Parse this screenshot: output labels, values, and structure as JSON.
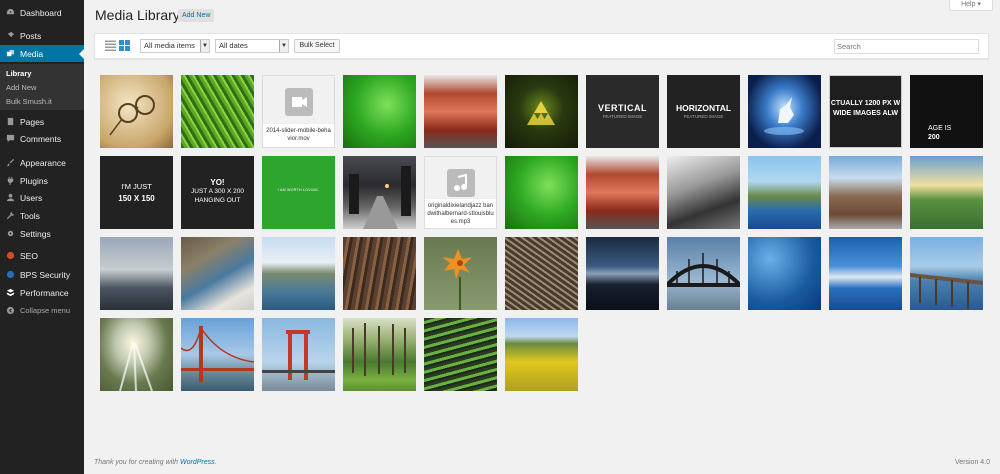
{
  "sidebar": {
    "items": [
      {
        "label": "Dashboard",
        "icon": "dashboard-icon"
      },
      {
        "label": "Posts",
        "icon": "pin-icon"
      },
      {
        "label": "Media",
        "icon": "media-icon"
      },
      {
        "label": "Pages",
        "icon": "page-icon"
      },
      {
        "label": "Comments",
        "icon": "comment-icon"
      },
      {
        "label": "Appearance",
        "icon": "brush-icon"
      },
      {
        "label": "Plugins",
        "icon": "plug-icon"
      },
      {
        "label": "Users",
        "icon": "user-icon"
      },
      {
        "label": "Tools",
        "icon": "wrench-icon"
      },
      {
        "label": "Settings",
        "icon": "settings-icon"
      },
      {
        "label": "SEO",
        "icon": "seo-icon"
      },
      {
        "label": "BPS Security",
        "icon": "shield-icon"
      },
      {
        "label": "Performance",
        "icon": "performance-icon"
      },
      {
        "label": "Collapse menu",
        "icon": "collapse-icon"
      }
    ],
    "submenu": [
      "Library",
      "Add New",
      "Bulk Smush.it"
    ]
  },
  "header": {
    "title": "Media Library",
    "add_new": "Add New",
    "help": "Help ▾"
  },
  "toolbar": {
    "filter_type": "All media items",
    "filter_date": "All dates",
    "bulk_select": "Bulk Select",
    "search_placeholder": "Search"
  },
  "tiles": {
    "file1": "2014-slider-mobile-behavior.mov",
    "file2": "originaldixielandjazz bandwithalbernard-stlouisblues.mp3",
    "vertical": "VERTICAL",
    "horizontal": "HORIZONTAL",
    "featured_image": "FEATURED IMAGE",
    "actually": "CTUALLY 1200 PX W",
    "wide": "WIDE IMAGES ALW",
    "image_is": "AGE IS",
    "image_is_num": "200",
    "im_just": "I'M JUST",
    "im_just_size": "150 X 150",
    "yo": "YO!",
    "just_a": "JUST A 300 X 200",
    "hanging": "HANGING OUT",
    "worth_loving": "I AM WORTH LOVING."
  },
  "footer": {
    "thanks": "Thank you for creating with",
    "wordpress": "WordPress",
    "version": "Version 4.0"
  },
  "colors": {
    "sidebar_bg": "#222222",
    "active_bg": "#0074a2",
    "page_bg": "#f1f1f1"
  }
}
